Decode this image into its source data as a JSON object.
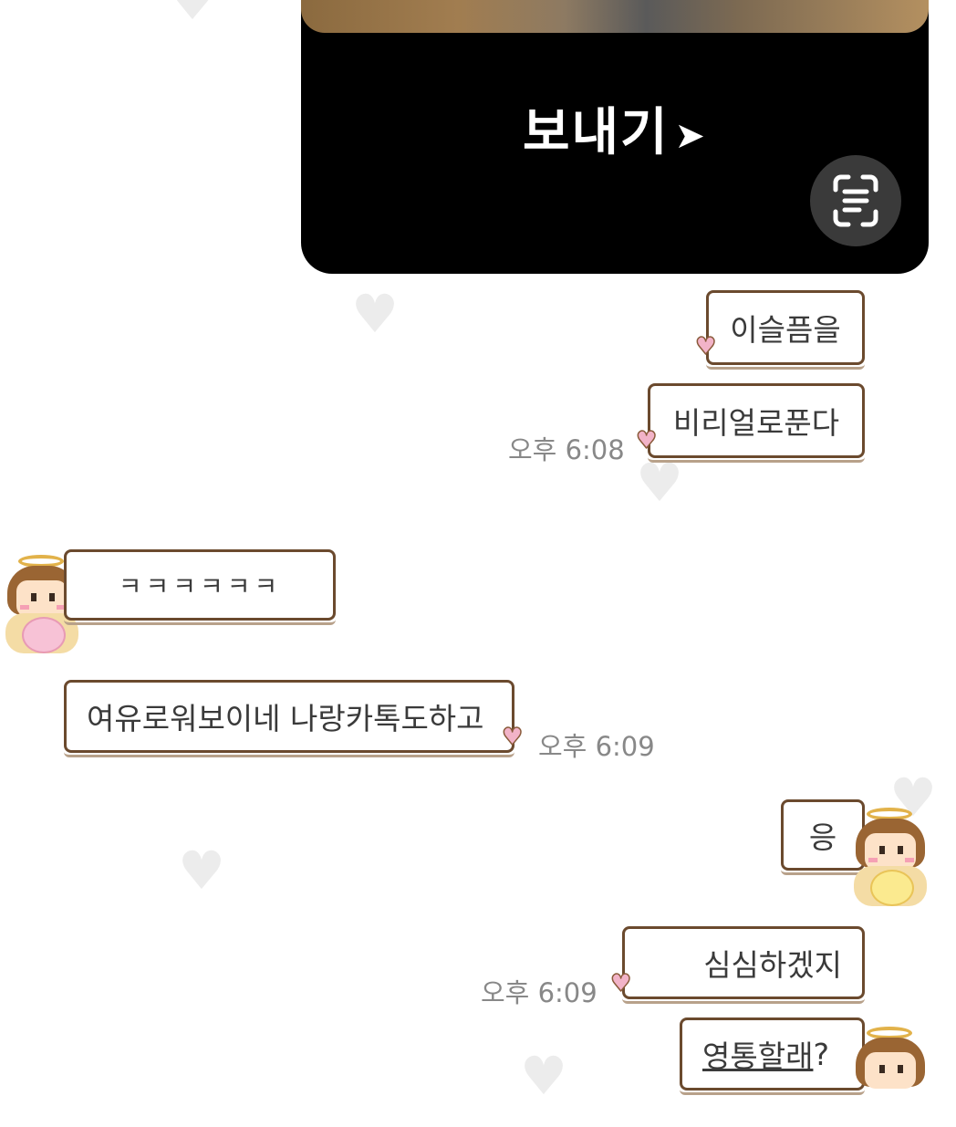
{
  "media": {
    "send_label": "보내기",
    "send_arrow_icon": "play-arrow-icon",
    "scan_icon": "text-scan-icon"
  },
  "messages": {
    "m1": "이슬픔을",
    "m2": "비리얼로푼다",
    "m2_time": "오후 6:08",
    "m3": "ㅋㅋㅋㅋㅋㅋ",
    "m4": "여유로워보이네 나랑카톡도하고",
    "m4_time": "오후 6:09",
    "m5": "응",
    "m6": "심심하겠지",
    "m6_time": "오후 6:09",
    "m7_link": "영통할래",
    "m7_tail": "?"
  },
  "colors": {
    "bubble_border": "#6b4a2e",
    "card_bg": "#000000",
    "time_text": "#888888",
    "heart_tail": "#f2b3c8"
  }
}
